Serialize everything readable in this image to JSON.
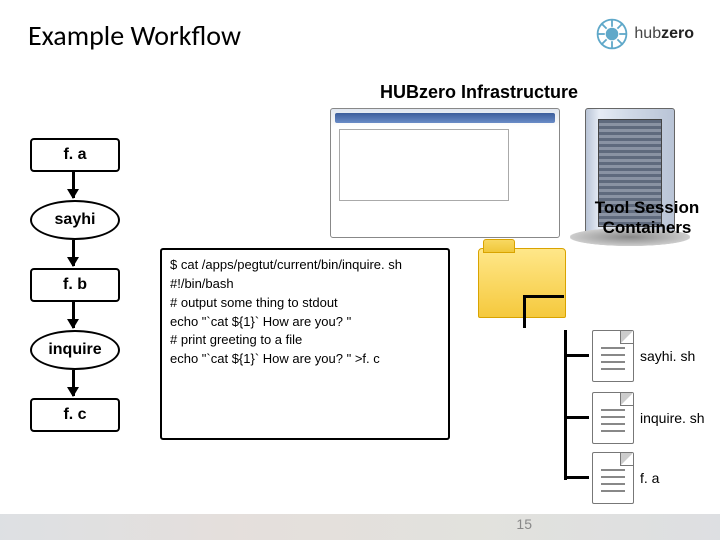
{
  "title": "Example Workflow",
  "logo": {
    "text_light": "hub",
    "text_bold": "zero"
  },
  "section_label": "HUBzero Infrastructure",
  "tool_label": "Tool Session Containers",
  "workflow": {
    "n1": "f. a",
    "n2": "sayhi",
    "n3": "f. b",
    "n4": "inquire",
    "n5": "f. c"
  },
  "code": {
    "l1": "$ cat /apps/pegtut/current/bin/inquire. sh",
    "l2": "",
    "l3": "#!/bin/bash",
    "l4": "",
    "l5": "# output some thing to stdout",
    "l6": "echo \"`cat ${1}` How are you? \"",
    "l7": "",
    "l8": "# print greeting to a file",
    "l9": "echo \"`cat ${1}` How are you? \" >f. c"
  },
  "files": {
    "f1": "sayhi. sh",
    "f2": "inquire. sh",
    "f3": "f. a"
  },
  "slide_number": "15"
}
